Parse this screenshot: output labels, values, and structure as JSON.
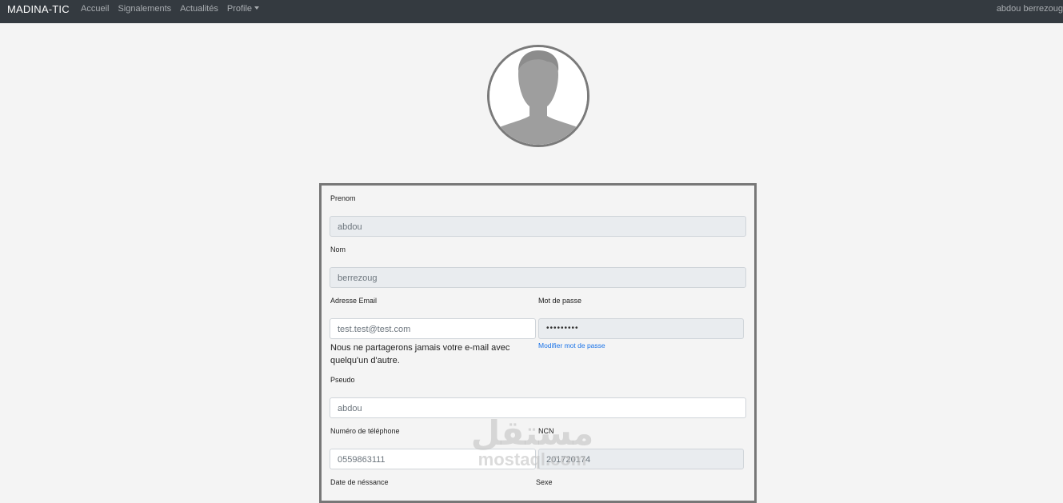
{
  "navbar": {
    "brand": "MADINA-TIC",
    "links": [
      "Accueil",
      "Signalements",
      "Actualités",
      "Profile"
    ],
    "user": "abdou berrezoug"
  },
  "avatar": {
    "icon": "user-silhouette-icon"
  },
  "form": {
    "prenom": {
      "label": "Prenom",
      "value": "abdou"
    },
    "nom": {
      "label": "Nom",
      "value": "berrezoug"
    },
    "email": {
      "label": "Adresse Email",
      "value": "test.test@test.com",
      "help": "Nous ne partagerons jamais votre e-mail avec quelqu'un d'autre."
    },
    "password": {
      "label": "Mot de passe",
      "value": "•••••••••",
      "link": "Modifier mot de passe"
    },
    "pseudo": {
      "label": "Pseudo",
      "value": "abdou"
    },
    "phone": {
      "label": "Numéro de téléphone",
      "value": "0559863111"
    },
    "ncn": {
      "label": "NCN",
      "value": "201720174"
    },
    "birthdate": {
      "label": "Date de néssance"
    },
    "sexe": {
      "label": "Sexe"
    }
  },
  "watermark": {
    "arabic": "مستقل",
    "latin": "mostaql.com"
  }
}
